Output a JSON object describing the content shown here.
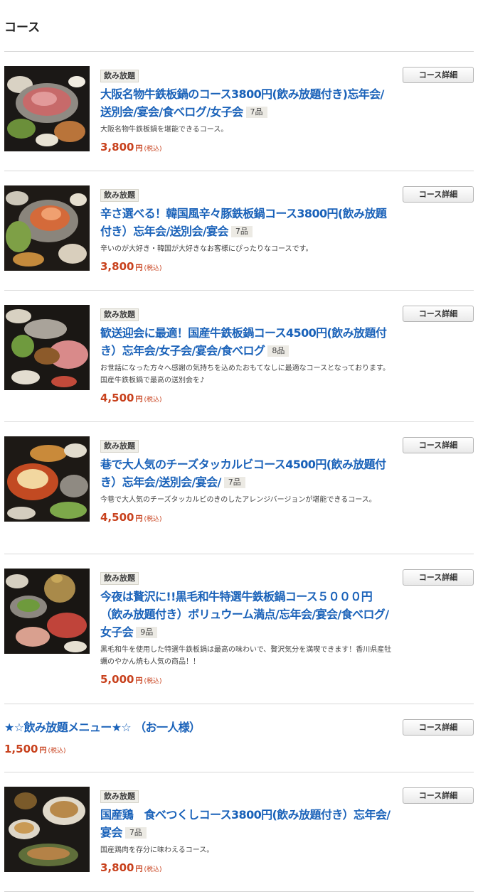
{
  "section": {
    "heading": "コース"
  },
  "colors": {
    "title": "#1a62b9",
    "price": "#c8411d",
    "badge_bg": "#efeee8",
    "divider": "#d9d9d9"
  },
  "courses": [
    {
      "badge": "飲み放題",
      "title": "大阪名物牛鉄板鍋のコース3800円(飲み放題付き)忘年会/送別会/宴会/食べログ/女子会",
      "item_count": "7品",
      "description": "大阪名物牛鉄板鍋を堪能できるコース。",
      "price": "3,800",
      "yen": "円",
      "tax": "(税込)",
      "button": "コース詳細",
      "image_icon": "food-photo"
    },
    {
      "badge": "飲み放題",
      "title": "辛さ選べる！韓国風辛々豚鉄板鍋コース3800円(飲み放題付き）忘年会/送別会/宴会",
      "item_count": "7品",
      "description": "辛いのが大好き・韓国が大好きなお客様にぴったりなコースです。",
      "price": "3,800",
      "yen": "円",
      "tax": "(税込)",
      "button": "コース詳細",
      "image_icon": "food-photo"
    },
    {
      "badge": "飲み放題",
      "title": "歓送迎会に最適！国産牛鉄板鍋コース4500円(飲み放題付き）忘年会/女子会/宴会/食べログ",
      "item_count": "8品",
      "description": "お世話になった方々へ感謝の気持ちを込めたおもてなしに最適なコースとなっております。国産牛鉄板鍋で最高の送別会を♪",
      "price": "4,500",
      "yen": "円",
      "tax": "(税込)",
      "button": "コース詳細",
      "image_icon": "food-photo"
    },
    {
      "badge": "飲み放題",
      "title": "巷で大人気のチーズタッカルビコース4500円(飲み放題付き）忘年会/送別会/宴会/",
      "item_count": "7品",
      "description": "今巷で大人気のチーズタッカルビのきのしたアレンジバージョンが堪能できるコース。",
      "price": "4,500",
      "yen": "円",
      "tax": "(税込)",
      "button": "コース詳細",
      "image_icon": "food-photo"
    },
    {
      "badge": "飲み放題",
      "title": "今夜は贅沢に!!黒毛和牛特選牛鉄板鍋コース５０００円（飲み放題付き）ボリュウーム満点/忘年会/宴会/食べログ/女子会",
      "item_count": "9品",
      "description": "黒毛和牛を使用した特選牛鉄板鍋は最高の味わいで、贅沢気分を満喫できます！香川県産牡蠣のやかん焼も人気の商品！！",
      "price": "5,000",
      "yen": "円",
      "tax": "(税込)",
      "button": "コース詳細",
      "image_icon": "food-photo"
    },
    {
      "title": "★☆飲み放題メニュー★☆ （お一人様）",
      "price": "1,500",
      "yen": "円",
      "tax": "(税込)",
      "button": "コース詳細"
    },
    {
      "badge": "飲み放題",
      "title": "国産鶏　食べつくしコース3800円(飲み放題付き）忘年会/宴会",
      "item_count": "7品",
      "description": "国産鶏肉を存分に味わえるコース。",
      "price": "3,800",
      "yen": "円",
      "tax": "(税込)",
      "button": "コース詳細",
      "image_icon": "food-photo"
    }
  ]
}
